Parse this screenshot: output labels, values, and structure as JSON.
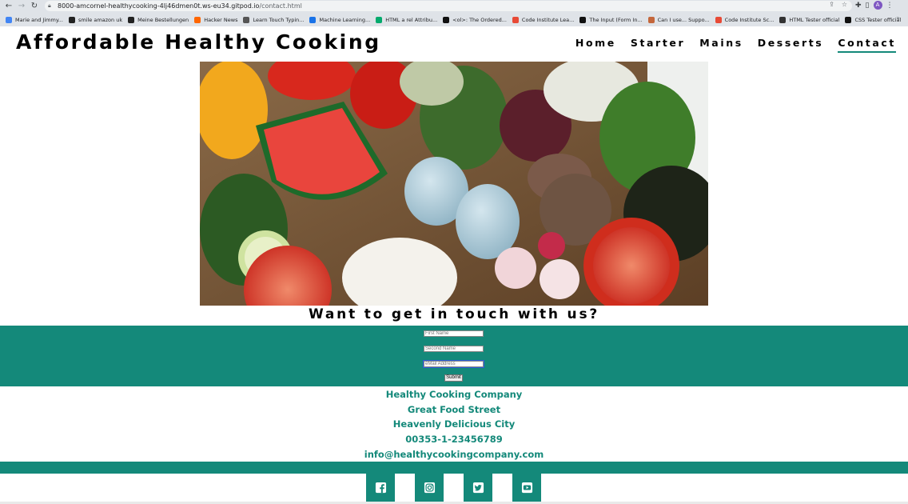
{
  "browser": {
    "url_host": "8000-amcornel-healthycooking-4lj46dmen0t.ws-eu34.gitpod.io",
    "url_path": "/contact.html",
    "profile_initial": "A",
    "bookmarks": [
      {
        "label": "Marie and Jimmy...",
        "icon": "google-icon",
        "color": "#4285f4"
      },
      {
        "label": "smile amazon uk",
        "icon": "amazon-icon",
        "color": "#222222"
      },
      {
        "label": "Meine Bestellungen",
        "icon": "amazon-icon",
        "color": "#222222"
      },
      {
        "label": "Hacker News",
        "icon": "hacker-news-icon",
        "color": "#ff6600"
      },
      {
        "label": "Learn Touch Typin...",
        "icon": "typing-icon",
        "color": "#555555"
      },
      {
        "label": "Machine Learning...",
        "icon": "ml-icon",
        "color": "#1a73e8"
      },
      {
        "label": "HTML a rel Attribu...",
        "icon": "w3-icon",
        "color": "#04aa6d"
      },
      {
        "label": "<ol>: The Ordered...",
        "icon": "mdn-icon",
        "color": "#111111"
      },
      {
        "label": "Code Institute Lea...",
        "icon": "code-institute-icon",
        "color": "#e84a36"
      },
      {
        "label": "The Input (Form In...",
        "icon": "mdn-icon",
        "color": "#111111"
      },
      {
        "label": "Can I use... Suppo...",
        "icon": "caniuse-icon",
        "color": "#c4673c"
      },
      {
        "label": "Code Institute Sc...",
        "icon": "code-institute-icon",
        "color": "#e84a36"
      },
      {
        "label": "HTML Tester official",
        "icon": "validator-icon",
        "color": "#333333"
      },
      {
        "label": "CSS Tester official",
        "icon": "validator-icon",
        "color": "#111111"
      }
    ]
  },
  "site": {
    "title": "Affordable Healthy Cooking",
    "nav": [
      "Home",
      "Starter",
      "Mains",
      "Desserts",
      "Contact"
    ],
    "active_nav": "Contact",
    "brand_color": "#14897a"
  },
  "hero": {
    "image": "vegetables-photo"
  },
  "contact": {
    "heading": "Want to get in touch with us?",
    "first_name_placeholder": "First Name",
    "second_name_placeholder": "Second Name",
    "email_placeholder": "eMail Address",
    "submit_label": "Submit"
  },
  "address": {
    "company": "Healthy Cooking Company",
    "street": "Great Food Street",
    "city": "Heavenly Delicious City",
    "phone": "00353-1-23456789",
    "email": "info@healthycookingcompany.com"
  },
  "social": [
    "facebook-icon",
    "instagram-icon",
    "twitter-icon",
    "youtube-icon"
  ]
}
